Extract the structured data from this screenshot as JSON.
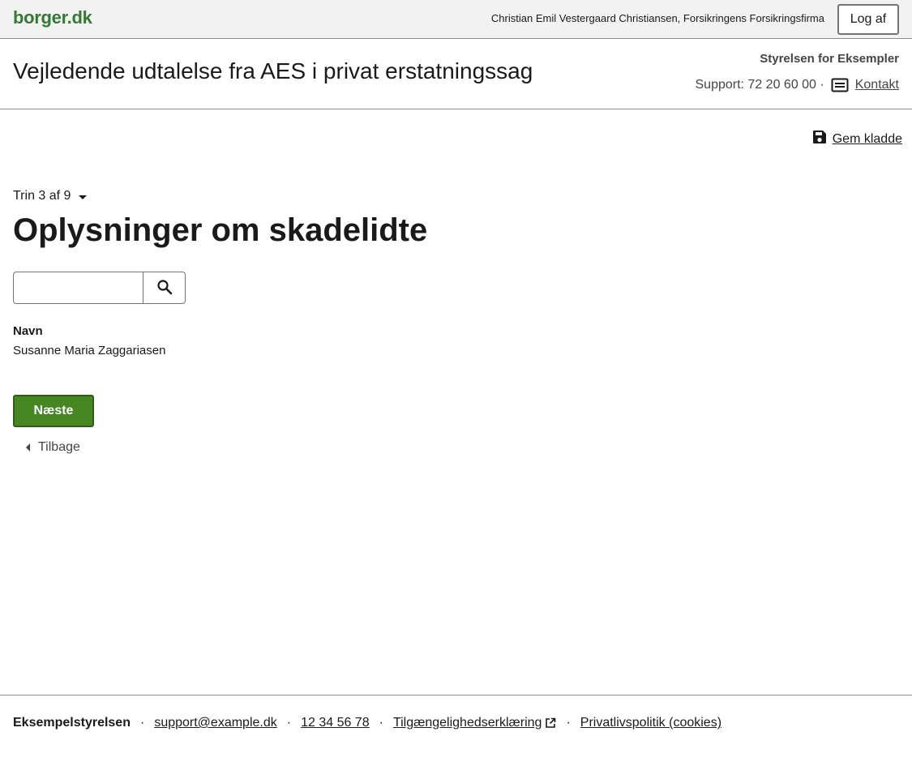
{
  "topbar": {
    "logo": "borger.dk",
    "user": "Christian Emil Vestergaard Christiansen, Forsikringens Forsikringsfirma",
    "logout_label": "Log af"
  },
  "header": {
    "title": "Vejledende udtalelse fra AES i privat erstatningssag",
    "authority": "Styrelsen for Eksempler",
    "support_label": "Support: 72 20 60 00 ·",
    "contact_label": "Kontakt"
  },
  "save_draft": {
    "label": "Gem kladde",
    "icon": "save-icon"
  },
  "step": {
    "label": "Trin 3 af 9"
  },
  "page": {
    "title": "Oplysninger om skadelidte"
  },
  "search": {
    "value": "",
    "placeholder": "",
    "icon": "search-icon"
  },
  "field": {
    "label": "Navn",
    "value": "Susanne Maria Zaggariasen"
  },
  "buttons": {
    "next": "Næste",
    "back": "Tilbage"
  },
  "footer": {
    "org": "Eksempelstyrelsen",
    "email": "support@example.dk",
    "phone": "12 34 56 78",
    "accessibility": "Tilgængelighedserklæring",
    "privacy": "Privatlivspolitik (cookies)",
    "separator": "·"
  },
  "colors": {
    "brand_green": "#357a32",
    "button_green": "#468623"
  }
}
